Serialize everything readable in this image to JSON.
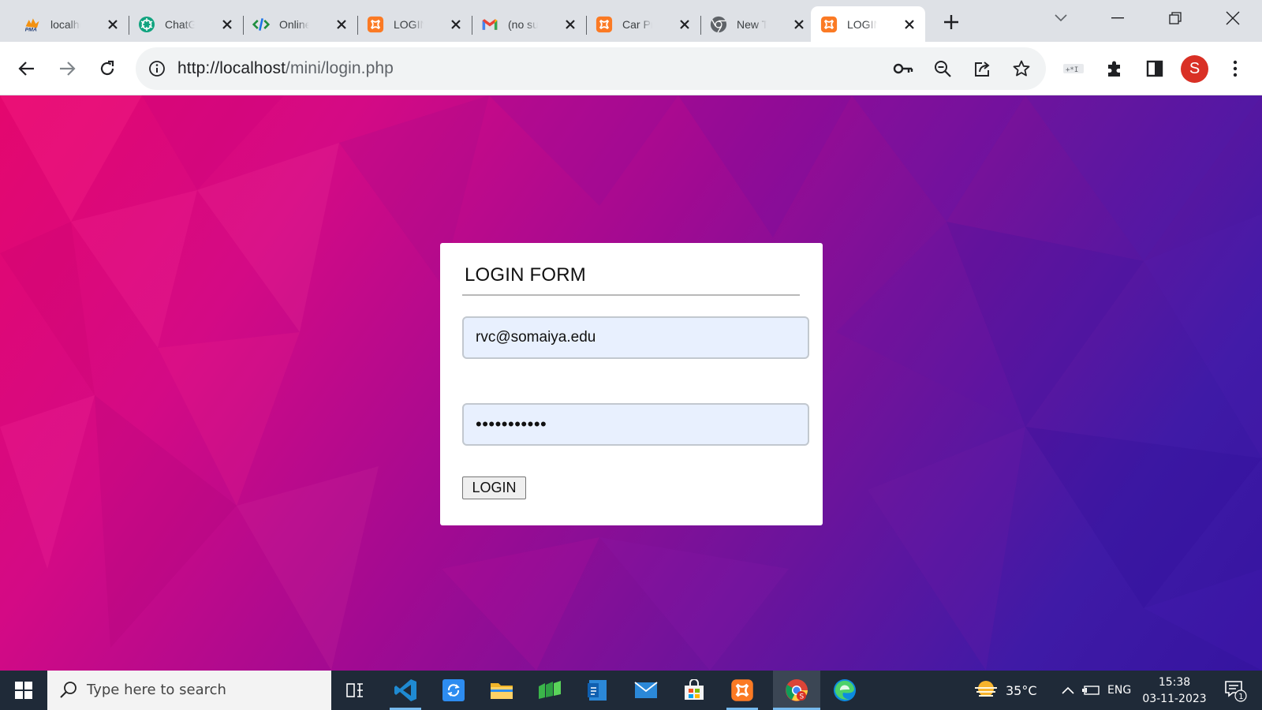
{
  "browser": {
    "tabs": [
      {
        "title": "localhost",
        "icon": "phpmyadmin-icon",
        "active": false
      },
      {
        "title": "ChatGPT",
        "icon": "chatgpt-icon",
        "active": false
      },
      {
        "title": "Online",
        "icon": "code-icon",
        "active": false
      },
      {
        "title": "LOGIN",
        "icon": "xampp-icon",
        "active": false
      },
      {
        "title": "(no subject)",
        "icon": "gmail-icon",
        "active": false
      },
      {
        "title": "Car Pr",
        "icon": "xampp-icon",
        "active": false
      },
      {
        "title": "New Tab",
        "icon": "chrome-icon",
        "active": false
      },
      {
        "title": "LOGIN",
        "icon": "xampp-icon",
        "active": true
      }
    ],
    "url": {
      "host": "http://localhost",
      "path": "/mini/login.php"
    },
    "profile_initial": "S",
    "accent_colors": {
      "profile": "#d93025",
      "tabstrip": "#dee1e6"
    }
  },
  "login_form": {
    "title": "LOGIN FORM",
    "email_value": "rvc@somaiya.edu",
    "password_value": "•••••••••••",
    "button_label": "LOGIN"
  },
  "taskbar": {
    "search_placeholder": "Type here to search",
    "weather": "35°C",
    "language": "ENG",
    "time": "15:38",
    "date": "03-11-2023",
    "notification_count": "1"
  }
}
